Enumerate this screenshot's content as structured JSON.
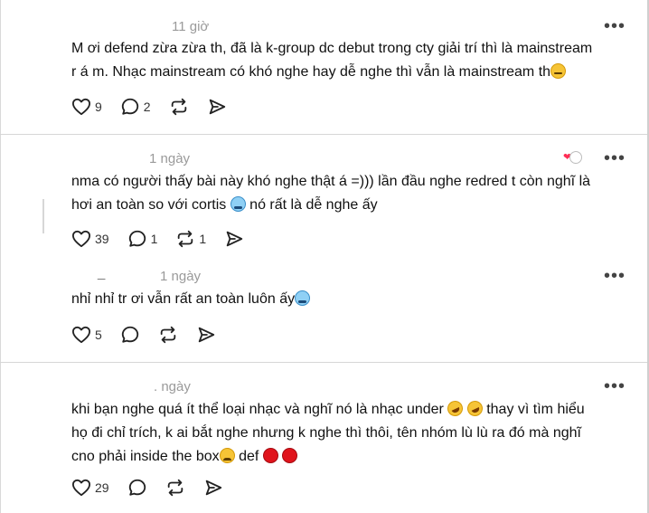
{
  "posts": [
    {
      "timestamp": "11 giờ",
      "more": "•••",
      "line1": "M ơi defend zừa zừa th, đã là k-group dc debut trong cty giải trí thì là mainstream",
      "line2": "r á m. Nhạc mainstream có khó nghe hay dễ nghe thì vẫn là mainstream th",
      "line2_emoji": "smirk-emoji",
      "likes": "9",
      "replies": "2",
      "reposts": ""
    },
    {
      "timestamp": "1 ngày",
      "more": "•••",
      "line1": "nma có người thấy bài này khó nghe thật á =))) lần đầu nghe redred t còn nghĩ là",
      "line2a": "hơi an toàn so với cortis ",
      "line2_emoji": "crying-emoji",
      "line2b": " nó rất là dễ nghe ấy",
      "likes": "39",
      "replies": "1",
      "reposts": "1"
    },
    {
      "handle": "_",
      "timestamp": "1 ngày",
      "more": "•••",
      "line1a": "nhỉ nhỉ tr ơi vẫn rất an toàn luôn ấy",
      "line1_emoji": "crying-emoji",
      "likes": "5",
      "replies": "",
      "reposts": ""
    },
    {
      "timestamp": ". ngày",
      "more": "•••",
      "line1a": "khi bạn nghe quá ít thể loại nhạc và nghĩ nó là nhạc under ",
      "line1_emojis": [
        "rofl-emoji",
        "rofl-emoji"
      ],
      "line1b": " thay vì tìm hiểu",
      "line2": "họ đi chỉ trích, k ai bắt nghe nhưng k nghe thì thôi, tên nhóm lù lù ra đó mà nghĩ",
      "line3a": "cno phải inside the box",
      "line3_emoji": "worried-emoji",
      "line3b": " def ",
      "line3_end_emojis": [
        "red-circle-emoji",
        "red-circle-emoji"
      ],
      "likes": "29",
      "replies": "",
      "reposts": ""
    }
  ]
}
